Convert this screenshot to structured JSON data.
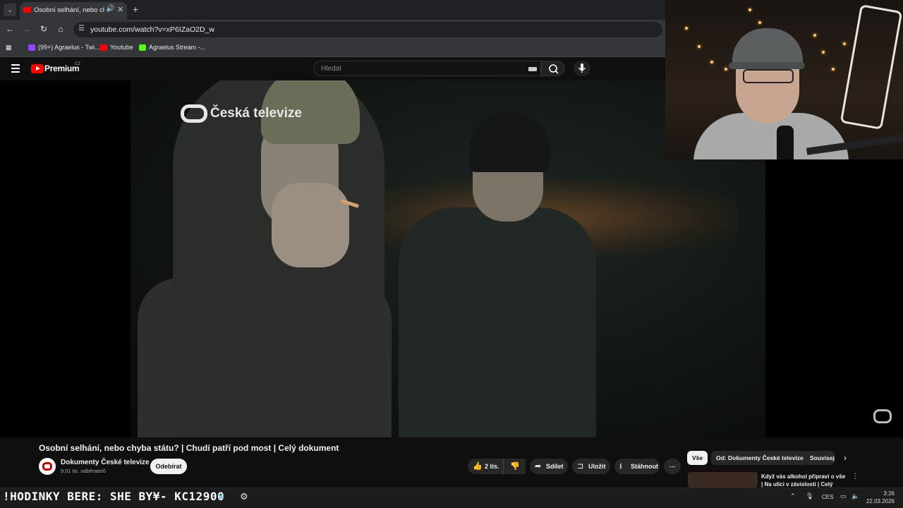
{
  "browser": {
    "tab": {
      "title": "Osobní selhání, nebo chyba státu? | Chudí patří pod most | Celý dokument"
    },
    "url": "youtube.com/watch?v=xP6IZaO2D_w",
    "bookmarks": [
      {
        "label": "(99+) Agraelus - Twi...",
        "color": "#9146ff"
      },
      {
        "label": "Youtube",
        "color": "#ff0000"
      },
      {
        "label": "Agraelus Stream -...",
        "color": "#53fc18"
      }
    ]
  },
  "youtube": {
    "brand": "Premium",
    "region": "CZ",
    "search_placeholder": "Hledat",
    "video": {
      "broadcaster_logo": "Česká televize",
      "title": "Osobní selhání, nebo chyba státu? | Chudí patří pod most | Celý dokument",
      "channel": "Dokumenty České televize",
      "subscribers": "9,01 tis. odběratelů",
      "subscribe_label": "Odebírat",
      "likes": "2 tis.",
      "share_label": "Sdílet",
      "save_label": "Uložit",
      "download_label": "Stáhnout"
    },
    "chips": [
      "Vše",
      "Od: Dokumenty České televize",
      "Souvisej"
    ],
    "recommendation": {
      "title": "Když vás alkohol připraví o vše | Na ulici v závislosti | Celý"
    }
  },
  "taskbar": {
    "ticker": "!HODINKY BERE: SHE  BY¥- KC12900",
    "language": "CES",
    "time": "3:26",
    "date": "22.03.2026"
  },
  "colors": {
    "accent": "#ff0000",
    "background": "#0f0f0f"
  }
}
